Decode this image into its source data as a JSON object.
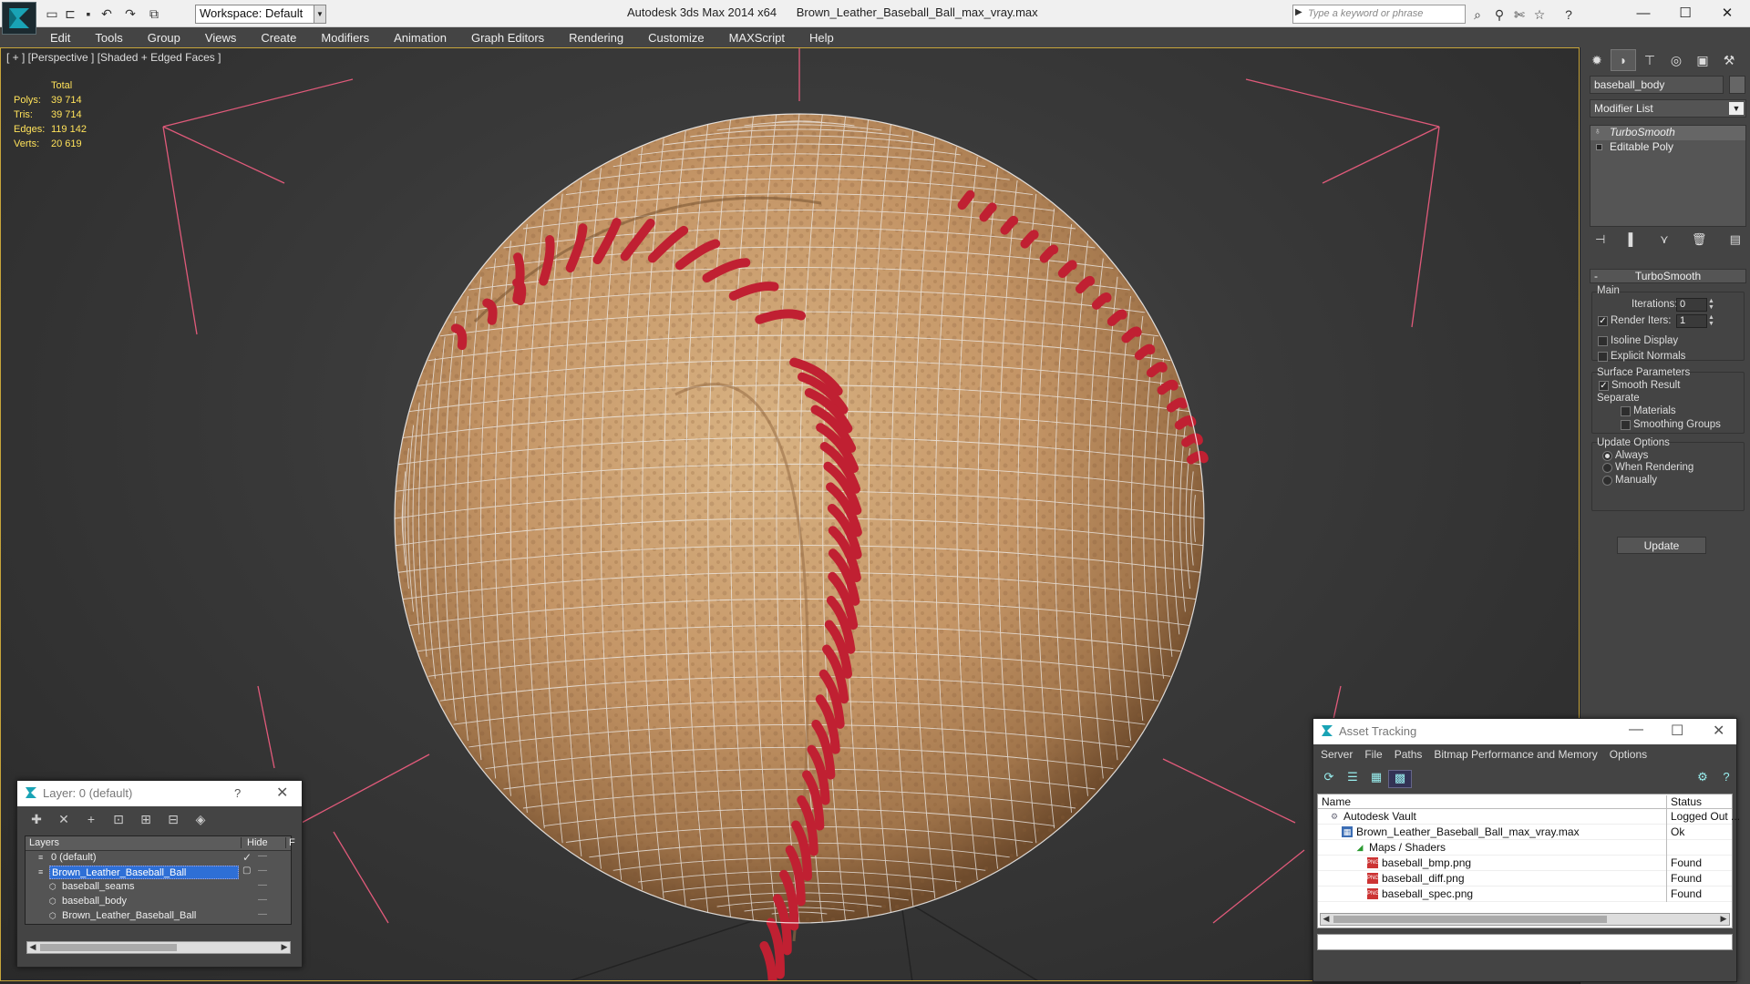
{
  "titlebar": {
    "workspace": "Workspace: Default",
    "app_name": "Autodesk 3ds Max  2014 x64",
    "file_name": "Brown_Leather_Baseball_Ball_max_vray.max",
    "search_placeholder": "Type a keyword or phrase",
    "window_minimize": "—",
    "window_maximize": "☐",
    "window_close": "✕"
  },
  "menu": [
    "Edit",
    "Tools",
    "Group",
    "Views",
    "Create",
    "Modifiers",
    "Animation",
    "Graph Editors",
    "Rendering",
    "Customize",
    "MAXScript",
    "Help"
  ],
  "viewport": {
    "label": "[ + ] [Perspective ] [Shaded + Edged Faces ]",
    "stats_header": "Total",
    "stats": [
      {
        "key": "Polys:",
        "value": "39 714"
      },
      {
        "key": "Tris:",
        "value": "39 714"
      },
      {
        "key": "Edges:",
        "value": "119 142"
      },
      {
        "key": "Verts:",
        "value": "20 619"
      }
    ],
    "colors": {
      "stats": "#ffe25a",
      "frame": "#c7a53b",
      "leather": "#c9a070",
      "stitch": "#c02032",
      "helpers": "#e05a7a"
    }
  },
  "command_panel": {
    "object_name": "baseball_body",
    "modifier_list": "Modifier List",
    "stack": [
      "TurboSmooth",
      "Editable Poly"
    ],
    "rollout_title": "TurboSmooth",
    "main_label": "Main",
    "iterations_label": "Iterations:",
    "iterations_value": "0",
    "render_iters_label": "Render Iters:",
    "render_iters_value": "1",
    "render_iters_checked": true,
    "isoline_label": "Isoline Display",
    "explicit_normals_label": "Explicit Normals",
    "surface_params_label": "Surface Parameters",
    "smooth_result_label": "Smooth Result",
    "separate_label": "Separate",
    "materials_label": "Materials",
    "smoothing_groups_label": "Smoothing Groups",
    "update_options_label": "Update Options",
    "update_always": "Always",
    "update_when_rendering": "When Rendering",
    "update_manually": "Manually",
    "update_button": "Update"
  },
  "layer_window": {
    "title": "Layer: 0 (default)",
    "help": "?",
    "close": "✕",
    "col_layers": "Layers",
    "col_hide": "Hide",
    "col_f": "F",
    "rows": [
      {
        "name": "0 (default)",
        "indent": 0
      },
      {
        "name": "Brown_Leather_Baseball_Ball",
        "indent": 0
      },
      {
        "name": "baseball_seams",
        "indent": 1
      },
      {
        "name": "baseball_body",
        "indent": 1
      },
      {
        "name": "Brown_Leather_Baseball_Ball",
        "indent": 1
      }
    ]
  },
  "asset_window": {
    "title": "Asset Tracking",
    "menu": [
      "Server",
      "File",
      "Paths",
      "Bitmap Performance and Memory",
      "Options"
    ],
    "col_name": "Name",
    "col_status": "Status",
    "rows": [
      {
        "name": "Autodesk Vault",
        "status": "Logged Out ...",
        "indent": 0,
        "icon": "vault-icon"
      },
      {
        "name": "Brown_Leather_Baseball_Ball_max_vray.max",
        "status": "Ok",
        "indent": 1,
        "icon": "max-file-icon"
      },
      {
        "name": "Maps / Shaders",
        "status": "",
        "indent": 2,
        "icon": "maps-icon"
      },
      {
        "name": "baseball_bmp.png",
        "status": "Found",
        "indent": 3,
        "icon": "png-icon"
      },
      {
        "name": "baseball_diff.png",
        "status": "Found",
        "indent": 3,
        "icon": "png-icon"
      },
      {
        "name": "baseball_spec.png",
        "status": "Found",
        "indent": 3,
        "icon": "png-icon"
      }
    ]
  }
}
